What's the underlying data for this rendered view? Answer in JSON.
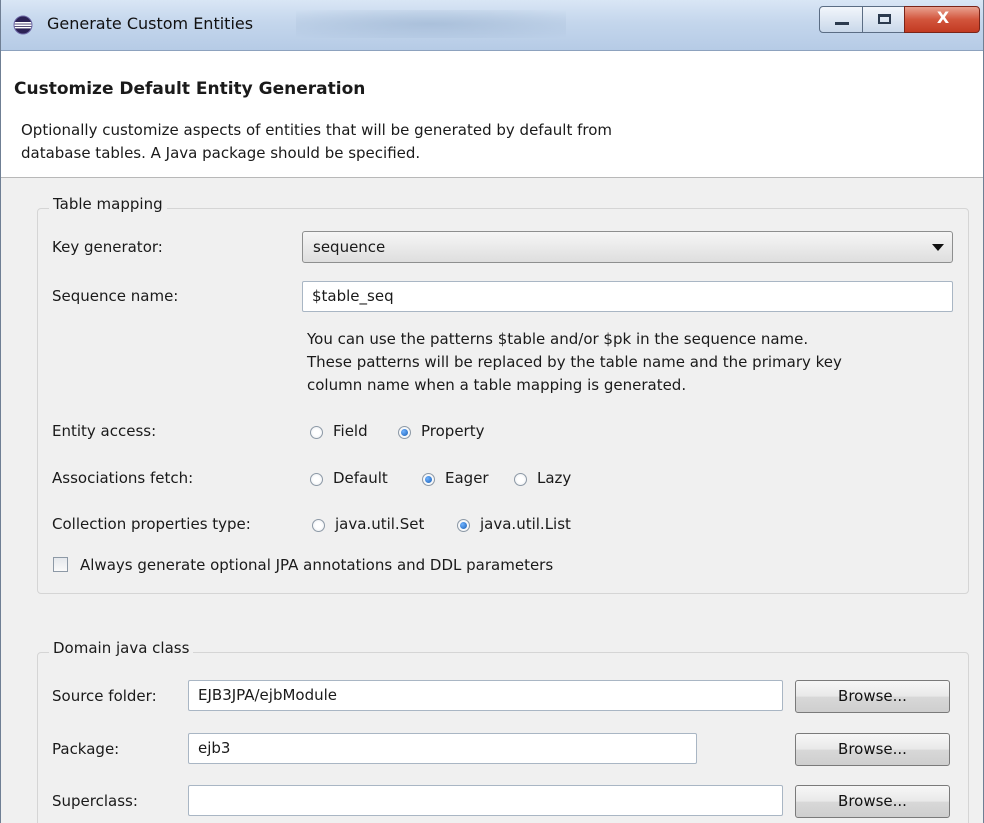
{
  "window": {
    "title": "Generate Custom Entities",
    "close_glyph": "X",
    "icons": [
      "eclipse-icon",
      "minimize-icon",
      "maximize-icon",
      "close-icon"
    ]
  },
  "header": {
    "title": "Customize Default Entity Generation",
    "description_line1": "Optionally customize aspects of entities that will be generated by default from",
    "description_line2": "database tables. A Java package should be specified."
  },
  "table_mapping": {
    "legend": "Table mapping",
    "key_generator_label": "Key generator:",
    "key_generator_value": "sequence",
    "sequence_name_label": "Sequence name:",
    "sequence_name_value": "$table_seq",
    "help_line1": "You can use the patterns $table and/or $pk in the sequence name.",
    "help_line2": "These patterns will be replaced by the table name and the primary key",
    "help_line3": "column name when a table mapping is generated.",
    "entity_access_label": "Entity access:",
    "entity_access_options": [
      "Field",
      "Property"
    ],
    "entity_access_selected": "Property",
    "associations_fetch_label": "Associations fetch:",
    "associations_fetch_options": [
      "Default",
      "Eager",
      "Lazy"
    ],
    "associations_fetch_selected": "Eager",
    "collection_type_label": "Collection properties type:",
    "collection_type_options": [
      "java.util.Set",
      "java.util.List"
    ],
    "collection_type_selected": "java.util.List",
    "optional_annotations_label": "Always generate optional JPA annotations and DDL parameters",
    "optional_annotations_checked": false
  },
  "domain_class": {
    "legend": "Domain java class",
    "source_folder_label": "Source folder:",
    "source_folder_value": "EJB3JPA/ejbModule",
    "package_label": "Package:",
    "package_value": "ejb3",
    "superclass_label": "Superclass:",
    "superclass_value": "",
    "browse_label": "Browse..."
  }
}
